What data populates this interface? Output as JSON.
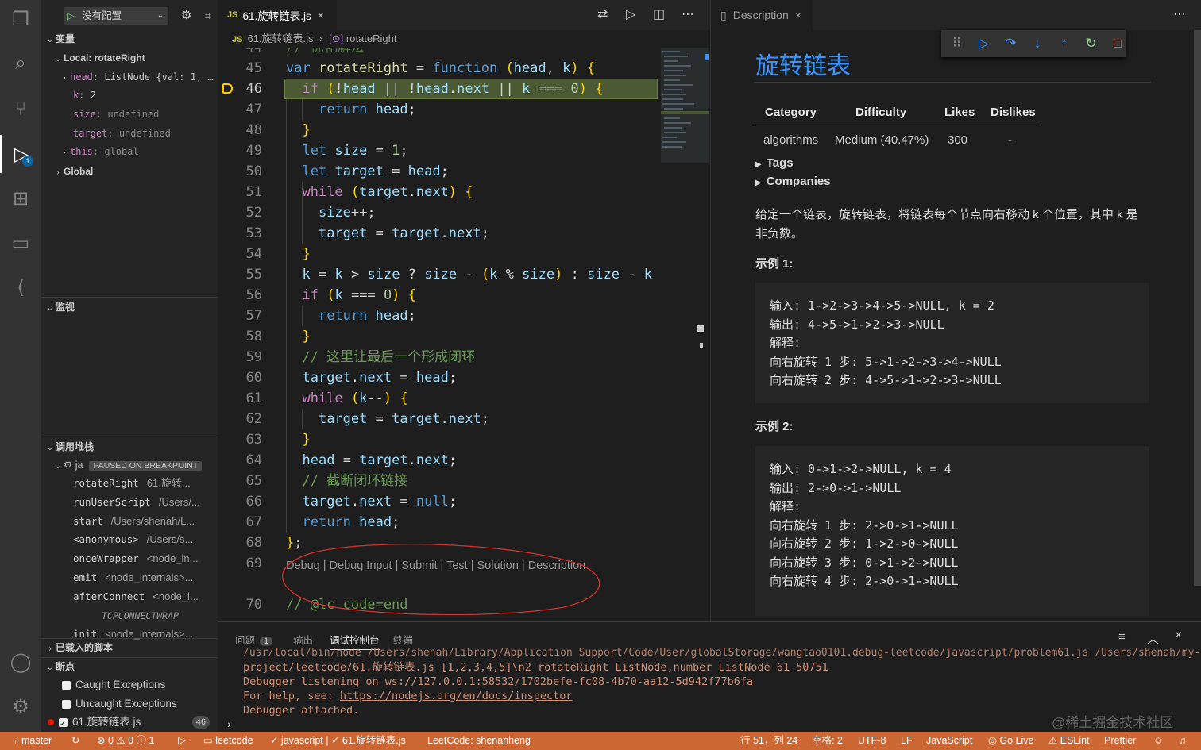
{
  "activity_bar": {
    "debug_badge": "1"
  },
  "sidebar": {
    "run_config": "没有配置",
    "variables_title": "变量",
    "local_scope": "Local: rotateRight",
    "vars": [
      {
        "name": "head",
        "value": "ListNode {val: 1, …"
      },
      {
        "name": "k",
        "value": "2"
      },
      {
        "name": "size",
        "value": "undefined"
      },
      {
        "name": "target",
        "value": "undefined"
      },
      {
        "name": "this",
        "value": "global"
      }
    ],
    "global_scope": "Global",
    "watch_title": "监视",
    "callstack_title": "调用堆栈",
    "thread_name": "ja",
    "thread_status": "PAUSED ON BREAKPOINT",
    "frames": [
      {
        "fn": "rotateRight",
        "loc": "61.旋转..."
      },
      {
        "fn": "runUserScript",
        "loc": "/Users/..."
      },
      {
        "fn": "start",
        "loc": "/Users/shenah/L..."
      },
      {
        "fn": "<anonymous>",
        "loc": "/Users/s..."
      },
      {
        "fn": "onceWrapper",
        "loc": "<node_in..."
      },
      {
        "fn": "emit",
        "loc": "<node_internals>..."
      },
      {
        "fn": "afterConnect",
        "loc": "<node_i..."
      },
      {
        "fn": "TCPCONNECTWRAP",
        "loc": ""
      },
      {
        "fn": "init",
        "loc": "<node_internals>..."
      }
    ],
    "loaded_scripts_title": "已载入的脚本",
    "breakpoints_title": "断点",
    "breakpoints": [
      {
        "label": "Caught Exceptions"
      },
      {
        "label": "Uncaught Exceptions"
      },
      {
        "label": "61.旋转链表.js",
        "count": "46"
      }
    ]
  },
  "editor": {
    "tab_title": "61.旋转链表.js",
    "breadcrumb_file": "61.旋转链表.js",
    "breadcrumb_symbol": "rotateRight",
    "top_partial_text": "// 优化解法",
    "lines": [
      {
        "n": "45",
        "code": "var rotateRight = function (head, k) {"
      },
      {
        "n": "46",
        "code": "  if (!head || !head.next || k === 0) {"
      },
      {
        "n": "47",
        "code": "    return head;"
      },
      {
        "n": "48",
        "code": "  }"
      },
      {
        "n": "49",
        "code": "  let size = 1;"
      },
      {
        "n": "50",
        "code": "  let target = head;"
      },
      {
        "n": "51",
        "code": "  while (target.next) {"
      },
      {
        "n": "52",
        "code": "    size++;"
      },
      {
        "n": "53",
        "code": "    target = target.next;"
      },
      {
        "n": "54",
        "code": "  }"
      },
      {
        "n": "55",
        "code": "  k = k > size ? size - (k % size) : size - k"
      },
      {
        "n": "56",
        "code": "  if (k === 0) {"
      },
      {
        "n": "57",
        "code": "    return head;"
      },
      {
        "n": "58",
        "code": "  }"
      },
      {
        "n": "59",
        "code": "  // 这里让最后一个形成闭环"
      },
      {
        "n": "60",
        "code": "  target.next = head;"
      },
      {
        "n": "61",
        "code": "  while (k--) {"
      },
      {
        "n": "62",
        "code": "    target = target.next;"
      },
      {
        "n": "63",
        "code": "  }"
      },
      {
        "n": "64",
        "code": "  head = target.next;"
      },
      {
        "n": "65",
        "code": "  // 截断闭环链接"
      },
      {
        "n": "66",
        "code": "  target.next = null;"
      },
      {
        "n": "67",
        "code": "  return head;"
      },
      {
        "n": "68",
        "code": "};"
      },
      {
        "n": "69",
        "code": ""
      },
      {
        "n": "70",
        "code": "// @lc code=end"
      }
    ],
    "codelens": "Debug | Debug Input | Submit | Test | Solution | Description"
  },
  "description": {
    "tab_title": "Description",
    "title": "旋转链表",
    "table_headers": [
      "Category",
      "Difficulty",
      "Likes",
      "Dislikes"
    ],
    "table_values": [
      "algorithms",
      "Medium (40.47%)",
      "300",
      "-"
    ],
    "tags_label": "Tags",
    "companies_label": "Companies",
    "intro_line1": "给定一个链表，旋转链表，将链表每个节点向右移动 k 个位置，其中 k 是",
    "intro_line2": "非负数。",
    "example1_title": "示例 1:",
    "example1_body": "输入: 1->2->3->4->5->NULL, k = 2\n输出: 4->5->1->2->3->NULL\n解释:\n向右旋转 1 步: 5->1->2->3->4->NULL\n向右旋转 2 步: 4->5->1->2->3->NULL",
    "example2_title": "示例 2:",
    "example2_body": "输入: 0->1->2->NULL, k = 4\n输出: 2->0->1->NULL\n解释:\n向右旋转 1 步: 2->0->1->NULL\n向右旋转 2 步: 1->2->0->NULL\n向右旋转 3 步: 0->1->2->NULL\n向右旋转 4 步: 2->0->1->NULL"
  },
  "panel": {
    "tabs": [
      "问题",
      "输出",
      "调试控制台",
      "终端"
    ],
    "problems_count": "1",
    "output_lines": [
      "/usr/local/bin/node /Users/shenah/Library/Application Support/Code/User/globalStorage/wangtao0101.debug-leetcode/javascript/problem61.js /Users/shenah/my-",
      "project/leetcode/61.旋转链表.js [1,2,3,4,5]\\n2 rotateRight ListNode,number ListNode 61 50751",
      "Debugger listening on ws://127.0.0.1:58532/1702befe-fc08-4b70-aa12-5d942f77b6fa",
      "For help, see: ",
      "Debugger attached."
    ],
    "help_link": "https://nodejs.org/en/docs/inspector",
    "watermark": "@稀土掘金技术社区"
  },
  "status_bar": {
    "branch": "master",
    "errors": "0",
    "warnings": "0",
    "info": "1",
    "leetcode": "leetcode",
    "javascript_item": "javascript |",
    "file_item": "61.旋转链表.js",
    "leetcode_user": "LeetCode: shenanheng",
    "position": "行 51，列 24",
    "spaces": "空格: 2",
    "encoding": "UTF-8",
    "eol": "LF",
    "language": "JavaScript",
    "golive": "Go Live",
    "eslint": "ESLint",
    "prettier": "Prettier"
  },
  "colors": {
    "status_bg": "#cc6633",
    "title_blue": "#3794ff",
    "current_line": "#4b5a32"
  }
}
